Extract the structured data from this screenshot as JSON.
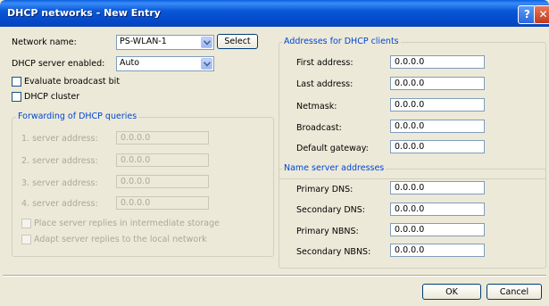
{
  "window": {
    "title": "DHCP networks - New Entry",
    "help_glyph": "?",
    "close_glyph": "✕"
  },
  "general": {
    "network_name_label": "Network name:",
    "network_name_value": "PS-WLAN-1",
    "select_label": "Select",
    "dhcp_enabled_label": "DHCP server enabled:",
    "dhcp_enabled_value": "Auto",
    "evaluate_broadcast_label": "Evaluate broadcast bit",
    "dhcp_cluster_label": "DHCP cluster"
  },
  "forwarding": {
    "title": "Forwarding of DHCP queries",
    "servers": [
      {
        "label": "1. server address:",
        "value": "0.0.0.0"
      },
      {
        "label": "2. server address:",
        "value": "0.0.0.0"
      },
      {
        "label": "3. server address:",
        "value": "0.0.0.0"
      },
      {
        "label": "4. server address:",
        "value": "0.0.0.0"
      }
    ],
    "place_replies_label": "Place server replies in intermediate storage",
    "adapt_replies_label": "Adapt server replies to the local network"
  },
  "addresses": {
    "title": "Addresses for DHCP clients",
    "rows": [
      {
        "label": "First address:",
        "value": "0.0.0.0"
      },
      {
        "label": "Last address:",
        "value": "0.0.0.0"
      },
      {
        "label": "Netmask:",
        "value": "0.0.0.0"
      },
      {
        "label": "Broadcast:",
        "value": "0.0.0.0"
      },
      {
        "label": "Default gateway:",
        "value": "0.0.0.0"
      }
    ]
  },
  "nameservers": {
    "title": "Name server addresses",
    "rows": [
      {
        "label": "Primary DNS:",
        "value": "0.0.0.0"
      },
      {
        "label": "Secondary DNS:",
        "value": "0.0.0.0"
      },
      {
        "label": "Primary NBNS:",
        "value": "0.0.0.0"
      },
      {
        "label": "Secondary NBNS:",
        "value": "0.0.0.0"
      }
    ]
  },
  "footer": {
    "ok_label": "OK",
    "cancel_label": "Cancel"
  }
}
